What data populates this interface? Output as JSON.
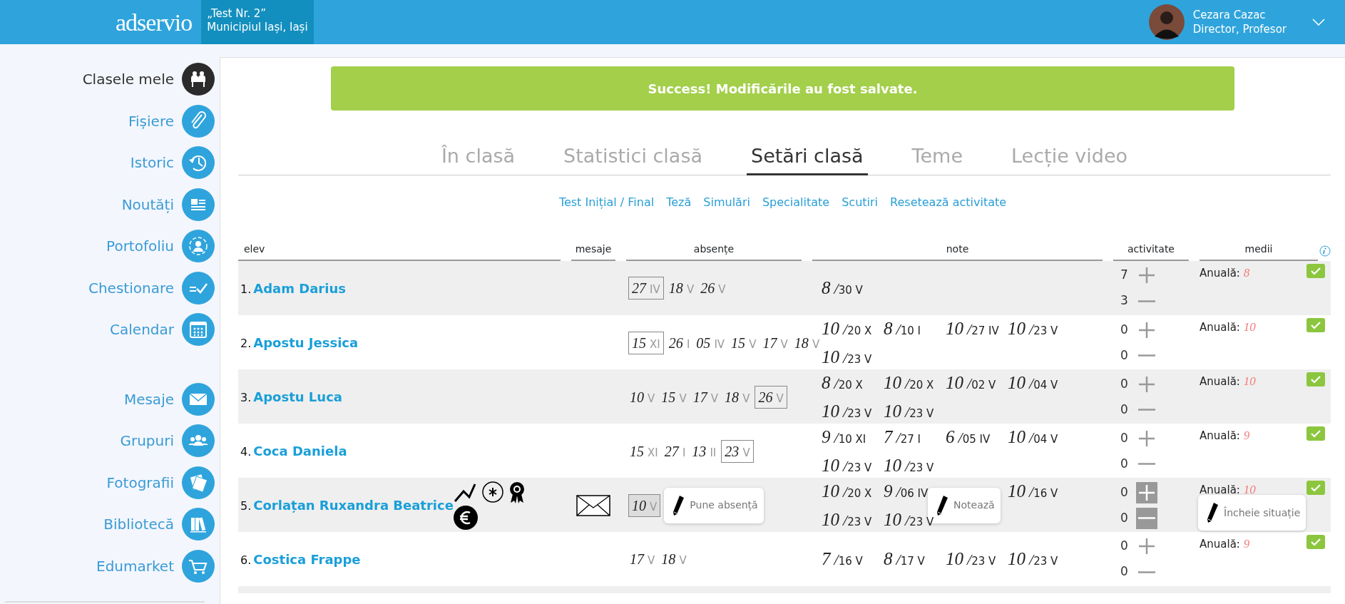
{
  "header": {
    "logo": "adservio",
    "school": {
      "name": "„Test Nr. 2”",
      "city": "Municipiul Iași, Iași"
    },
    "user": {
      "name": "Cezara Cazac",
      "role": "Director, Profesor"
    }
  },
  "sidebar": {
    "sections": [
      {
        "items": [
          {
            "label": "Clasele mele",
            "selected": true
          },
          {
            "label": "Fișiere",
            "selected": false
          },
          {
            "label": "Istoric",
            "selected": false
          },
          {
            "label": "Noutăți",
            "selected": false
          },
          {
            "label": "Portofoliu",
            "selected": false
          },
          {
            "label": "Chestionare",
            "selected": false
          },
          {
            "label": "Calendar",
            "selected": false
          }
        ]
      },
      {
        "items": [
          {
            "label": "Mesaje",
            "selected": false
          },
          {
            "label": "Grupuri",
            "selected": false
          },
          {
            "label": "Fotografii",
            "selected": false
          },
          {
            "label": "Bibliotecă",
            "selected": false
          },
          {
            "label": "Edumarket",
            "selected": false
          }
        ]
      }
    ]
  },
  "alert": {
    "text": "Success! Modificările au fost salvate."
  },
  "tabs": [
    {
      "label": "În clasă",
      "selected": false
    },
    {
      "label": "Statistici clasă",
      "selected": false
    },
    {
      "label": "Setări clasă",
      "selected": true
    },
    {
      "label": "Teme",
      "selected": false
    },
    {
      "label": "Lecție video",
      "selected": false
    }
  ],
  "links": [
    "Test Inițial / Final",
    "Teză",
    "Simulări",
    "Specialitate",
    "Scutiri",
    "Resetează activitate"
  ],
  "table": {
    "columns": [
      "elev",
      "mesaje",
      "absențe",
      "note",
      "activitate",
      "medii"
    ],
    "rows": [
      {
        "number": "1.",
        "name": "Adam Darius",
        "badges": [],
        "message": false,
        "absences": [
          {
            "kind": "absence",
            "day": "27",
            "month": "IV",
            "boxed": true,
            "shaded": false
          },
          {
            "kind": "absence",
            "day": "18",
            "month": "V",
            "boxed": false,
            "shaded": false
          },
          {
            "kind": "absence",
            "day": "26",
            "month": "V",
            "boxed": false,
            "shaded": false
          }
        ],
        "grades": [
          {
            "kind": "grade",
            "grade": "8",
            "date": "/30 V"
          }
        ],
        "activity": {
          "plus": "7",
          "minus": "3",
          "hovered": false
        },
        "average": {
          "label": "Anuală:",
          "value": "8",
          "confirmed": true
        }
      },
      {
        "number": "2.",
        "name": "Apostu Jessica",
        "badges": [],
        "message": false,
        "absences": [
          {
            "kind": "absence",
            "day": "15",
            "month": "XI",
            "boxed": true,
            "shaded": false
          },
          {
            "kind": "absence",
            "day": "26",
            "month": "I",
            "boxed": false,
            "shaded": false
          },
          {
            "kind": "absence",
            "day": "05",
            "month": "IV",
            "boxed": false,
            "shaded": false
          },
          {
            "kind": "absence",
            "day": "15",
            "month": "V",
            "boxed": false,
            "shaded": false
          },
          {
            "kind": "absence",
            "day": "17",
            "month": "V",
            "boxed": false,
            "shaded": false
          },
          {
            "kind": "absence",
            "day": "18",
            "month": "V",
            "boxed": false,
            "shaded": false
          }
        ],
        "grades": [
          {
            "kind": "grade",
            "grade": "10",
            "date": "/20 X"
          },
          {
            "kind": "grade",
            "grade": "8",
            "date": "/10 I"
          },
          {
            "kind": "grade",
            "grade": "10",
            "date": "/27 IV"
          },
          {
            "kind": "grade",
            "grade": "10",
            "date": "/23 V"
          },
          {
            "kind": "grade",
            "grade": "10",
            "date": "/23 V"
          }
        ],
        "activity": {
          "plus": "0",
          "minus": "0",
          "hovered": false
        },
        "average": {
          "label": "Anuală:",
          "value": "10",
          "confirmed": true
        }
      },
      {
        "number": "3.",
        "name": "Apostu Luca",
        "badges": [],
        "message": false,
        "absences": [
          {
            "kind": "absence",
            "day": "10",
            "month": "V",
            "boxed": false,
            "shaded": false
          },
          {
            "kind": "absence",
            "day": "15",
            "month": "V",
            "boxed": false,
            "shaded": false
          },
          {
            "kind": "absence",
            "day": "17",
            "month": "V",
            "boxed": false,
            "shaded": false
          },
          {
            "kind": "absence",
            "day": "18",
            "month": "V",
            "boxed": false,
            "shaded": false
          },
          {
            "kind": "absence",
            "day": "26",
            "month": "V",
            "boxed": true,
            "shaded": false
          }
        ],
        "grades": [
          {
            "kind": "grade",
            "grade": "8",
            "date": "/20 X"
          },
          {
            "kind": "grade",
            "grade": "10",
            "date": "/20 X"
          },
          {
            "kind": "grade",
            "grade": "10",
            "date": "/02 V"
          },
          {
            "kind": "grade",
            "grade": "10",
            "date": "/04 V"
          },
          {
            "kind": "grade",
            "grade": "10",
            "date": "/23 V"
          },
          {
            "kind": "grade",
            "grade": "10",
            "date": "/23 V"
          }
        ],
        "activity": {
          "plus": "0",
          "minus": "0",
          "hovered": false
        },
        "average": {
          "label": "Anuală:",
          "value": "10",
          "confirmed": true
        }
      },
      {
        "number": "4.",
        "name": "Coca Daniela",
        "badges": [],
        "message": false,
        "absences": [
          {
            "kind": "absence",
            "day": "15",
            "month": "XI",
            "boxed": false,
            "shaded": false
          },
          {
            "kind": "absence",
            "day": "27",
            "month": "I",
            "boxed": false,
            "shaded": false
          },
          {
            "kind": "absence",
            "day": "13",
            "month": "II",
            "boxed": false,
            "shaded": false
          },
          {
            "kind": "absence",
            "day": "23",
            "month": "V",
            "boxed": true,
            "shaded": false
          }
        ],
        "grades": [
          {
            "kind": "grade",
            "grade": "9",
            "date": "/10 XI"
          },
          {
            "kind": "grade",
            "grade": "7",
            "date": "/27 I"
          },
          {
            "kind": "grade",
            "grade": "6",
            "date": "/05 IV"
          },
          {
            "kind": "grade",
            "grade": "10",
            "date": "/04 V"
          },
          {
            "kind": "grade",
            "grade": "10",
            "date": "/23 V"
          },
          {
            "kind": "grade",
            "grade": "10",
            "date": "/23 V"
          }
        ],
        "activity": {
          "plus": "0",
          "minus": "0",
          "hovered": false
        },
        "average": {
          "label": "Anuală:",
          "value": "9",
          "confirmed": true
        }
      },
      {
        "number": "5.",
        "name": "Corlațan Ruxandra Beatrice",
        "badges": [
          {
            "kind": "trend"
          },
          {
            "kind": "asterisk"
          },
          {
            "kind": "award"
          },
          {
            "kind": "euro"
          }
        ],
        "message": true,
        "absences": [
          {
            "kind": "absence",
            "day": "10",
            "month": "V",
            "boxed": true,
            "shaded": true
          },
          {
            "kind": "tooltip",
            "label": "Pune absență"
          }
        ],
        "grades": [
          {
            "kind": "grade",
            "grade": "10",
            "date": "/20 X"
          },
          {
            "kind": "grade",
            "grade": "9",
            "date": "/06 IV"
          },
          {
            "kind": "tooltip",
            "label": "Notează"
          },
          {
            "kind": "grade",
            "grade": "10",
            "date": "/16 V"
          },
          {
            "kind": "grade",
            "grade": "10",
            "date": "/23 V"
          },
          {
            "kind": "grade",
            "grade": "10",
            "date": "/23 V"
          }
        ],
        "activity": {
          "plus": "0",
          "minus": "0",
          "hovered": true
        },
        "average": {
          "label": "Anuală:",
          "value": "10",
          "confirmed": true,
          "tooltip": "Încheie situație"
        }
      },
      {
        "number": "6.",
        "name": "Costica Frappe",
        "badges": [],
        "message": false,
        "absences": [
          {
            "kind": "absence",
            "day": "17",
            "month": "V",
            "boxed": false,
            "shaded": false
          },
          {
            "kind": "absence",
            "day": "18",
            "month": "V",
            "boxed": false,
            "shaded": false
          }
        ],
        "grades": [
          {
            "kind": "grade",
            "grade": "7",
            "date": "/16 V"
          },
          {
            "kind": "grade",
            "grade": "8",
            "date": "/17 V"
          },
          {
            "kind": "grade",
            "grade": "10",
            "date": "/23 V"
          },
          {
            "kind": "grade",
            "grade": "10",
            "date": "/23 V"
          }
        ],
        "activity": {
          "plus": "0",
          "minus": "0",
          "hovered": false
        },
        "average": {
          "label": "Anuală:",
          "value": "9",
          "confirmed": true
        }
      }
    ]
  }
}
